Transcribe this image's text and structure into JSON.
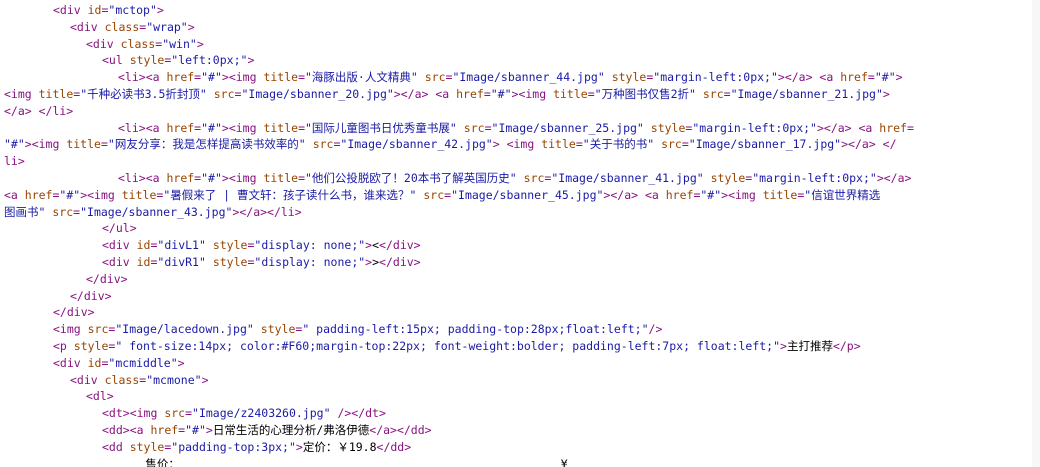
{
  "source": {
    "lines": [
      {
        "indent": 53,
        "segments": [
          [
            "t",
            "&lt;div "
          ],
          [
            "a",
            "id"
          ],
          [
            "t",
            "="
          ],
          [
            "v",
            "\"mctop\""
          ],
          [
            "t",
            "&gt;"
          ]
        ]
      },
      {
        "indent": 70,
        "segments": [
          [
            "t",
            "&lt;div "
          ],
          [
            "a",
            "class"
          ],
          [
            "t",
            "="
          ],
          [
            "v",
            "\"wrap\""
          ],
          [
            "t",
            "&gt;"
          ]
        ]
      },
      {
        "indent": 86,
        "segments": [
          [
            "t",
            "&lt;div "
          ],
          [
            "a",
            "class"
          ],
          [
            "t",
            "="
          ],
          [
            "v",
            "\"win\""
          ],
          [
            "t",
            "&gt;"
          ]
        ]
      },
      {
        "indent": 102,
        "segments": [
          [
            "t",
            "&lt;ul "
          ],
          [
            "a",
            "style"
          ],
          [
            "t",
            "="
          ],
          [
            "v",
            "\"left:0px;\""
          ],
          [
            "t",
            "&gt;"
          ]
        ]
      },
      {
        "indent": 118,
        "segments": [
          [
            "t",
            "&lt;li&gt;&lt;a "
          ],
          [
            "a",
            "href"
          ],
          [
            "t",
            "="
          ],
          [
            "v",
            "\"#\""
          ],
          [
            "t",
            "&gt;&lt;img "
          ],
          [
            "a",
            "title"
          ],
          [
            "t",
            "="
          ],
          [
            "v",
            "\"海豚出版·人文精典\""
          ],
          [
            "t",
            " "
          ],
          [
            "a",
            "src"
          ],
          [
            "t",
            "="
          ],
          [
            "v",
            "\"Image/sbanner_44.jpg\""
          ],
          [
            "t",
            " "
          ],
          [
            "a",
            "style"
          ],
          [
            "t",
            "="
          ],
          [
            "v",
            "\"margin-left:0px;\""
          ],
          [
            "t",
            "&gt;&lt;/a&gt; &lt;a "
          ],
          [
            "a",
            "href"
          ],
          [
            "t",
            "="
          ],
          [
            "v",
            "\"#\""
          ],
          [
            "t",
            "&gt;"
          ]
        ]
      },
      {
        "indent": 4,
        "segments": [
          [
            "t",
            "&lt;img "
          ],
          [
            "a",
            "title"
          ],
          [
            "t",
            "="
          ],
          [
            "v",
            "\"千种必读书3.5折封顶\""
          ],
          [
            "t",
            " "
          ],
          [
            "a",
            "src"
          ],
          [
            "t",
            "="
          ],
          [
            "v",
            "\"Image/sbanner_20.jpg\""
          ],
          [
            "t",
            "&gt;&lt;/a&gt; &lt;a "
          ],
          [
            "a",
            "href"
          ],
          [
            "t",
            "="
          ],
          [
            "v",
            "\"#\""
          ],
          [
            "t",
            "&gt;&lt;img "
          ],
          [
            "a",
            "title"
          ],
          [
            "t",
            "="
          ],
          [
            "v",
            "\"万种图书仅售2折\""
          ],
          [
            "t",
            " "
          ],
          [
            "a",
            "src"
          ],
          [
            "t",
            "="
          ],
          [
            "v",
            "\"Image/sbanner_21.jpg\""
          ],
          [
            "t",
            "&gt;"
          ]
        ]
      },
      {
        "indent": 4,
        "segments": [
          [
            "t",
            "&lt;/a&gt; &lt;/li&gt;"
          ]
        ]
      },
      {
        "indent": 118,
        "segments": [
          [
            "t",
            "&lt;li&gt;&lt;a "
          ],
          [
            "a",
            "href"
          ],
          [
            "t",
            "="
          ],
          [
            "v",
            "\"#\""
          ],
          [
            "t",
            "&gt;&lt;img "
          ],
          [
            "a",
            "title"
          ],
          [
            "t",
            "="
          ],
          [
            "v",
            "\"国际儿童图书日优秀童书展\""
          ],
          [
            "t",
            " "
          ],
          [
            "a",
            "src"
          ],
          [
            "t",
            "="
          ],
          [
            "v",
            "\"Image/sbanner_25.jpg\""
          ],
          [
            "t",
            " "
          ],
          [
            "a",
            "style"
          ],
          [
            "t",
            "="
          ],
          [
            "v",
            "\"margin-left:0px;\""
          ],
          [
            "t",
            "&gt;&lt;/a&gt; &lt;a "
          ],
          [
            "a",
            "href"
          ],
          [
            "t",
            "="
          ]
        ]
      },
      {
        "indent": 4,
        "segments": [
          [
            "v",
            "\"#\""
          ],
          [
            "t",
            "&gt;&lt;img "
          ],
          [
            "a",
            "title"
          ],
          [
            "t",
            "="
          ],
          [
            "v",
            "\"网友分享：我是怎样提高读书效率的\""
          ],
          [
            "t",
            " "
          ],
          [
            "a",
            "src"
          ],
          [
            "t",
            "="
          ],
          [
            "v",
            "\"Image/sbanner_42.jpg\""
          ],
          [
            "t",
            "&gt; &lt;img "
          ],
          [
            "a",
            "title"
          ],
          [
            "t",
            "="
          ],
          [
            "v",
            "\"关于书的书\""
          ],
          [
            "t",
            " "
          ],
          [
            "a",
            "src"
          ],
          [
            "t",
            "="
          ],
          [
            "v",
            "\"Image/sbanner_17.jpg\""
          ],
          [
            "t",
            "&gt;&lt;/a&gt; &lt;/"
          ]
        ]
      },
      {
        "indent": 4,
        "segments": [
          [
            "t",
            "li&gt;"
          ]
        ]
      },
      {
        "indent": 118,
        "segments": [
          [
            "t",
            "&lt;li&gt;&lt;a "
          ],
          [
            "a",
            "href"
          ],
          [
            "t",
            "="
          ],
          [
            "v",
            "\"#\""
          ],
          [
            "t",
            "&gt;&lt;img "
          ],
          [
            "a",
            "title"
          ],
          [
            "t",
            "="
          ],
          [
            "v",
            "\"他们公投脱欧了！20本书了解英国历史\""
          ],
          [
            "t",
            " "
          ],
          [
            "a",
            "src"
          ],
          [
            "t",
            "="
          ],
          [
            "v",
            "\"Image/sbanner_41.jpg\""
          ],
          [
            "t",
            " "
          ],
          [
            "a",
            "style"
          ],
          [
            "t",
            "="
          ],
          [
            "v",
            "\"margin-left:0px;\""
          ],
          [
            "t",
            "&gt;&lt;/a&gt;"
          ]
        ]
      },
      {
        "indent": 4,
        "segments": [
          [
            "t",
            "&lt;a "
          ],
          [
            "a",
            "href"
          ],
          [
            "t",
            "="
          ],
          [
            "v",
            "\"#\""
          ],
          [
            "t",
            "&gt;&lt;img "
          ],
          [
            "a",
            "title"
          ],
          [
            "t",
            "="
          ],
          [
            "v",
            "\"暑假来了 | 曹文轩：孩子读什么书，谁来选？\""
          ],
          [
            "t",
            " "
          ],
          [
            "a",
            "src"
          ],
          [
            "t",
            "="
          ],
          [
            "v",
            "\"Image/sbanner_45.jpg\""
          ],
          [
            "t",
            "&gt;&lt;/a&gt; &lt;a "
          ],
          [
            "a",
            "href"
          ],
          [
            "t",
            "="
          ],
          [
            "v",
            "\"#\""
          ],
          [
            "t",
            "&gt;&lt;img "
          ],
          [
            "a",
            "title"
          ],
          [
            "t",
            "="
          ],
          [
            "v",
            "\"信谊世界精选"
          ]
        ]
      },
      {
        "indent": 4,
        "segments": [
          [
            "v",
            "图画书\""
          ],
          [
            "t",
            " "
          ],
          [
            "a",
            "src"
          ],
          [
            "t",
            "="
          ],
          [
            "v",
            "\"Image/sbanner_43.jpg\""
          ],
          [
            "t",
            "&gt;&lt;/a&gt;&lt;/li&gt;"
          ]
        ]
      },
      {
        "indent": 102,
        "segments": [
          [
            "t",
            "&lt;/ul&gt;"
          ]
        ]
      },
      {
        "indent": 102,
        "segments": [
          [
            "t",
            "&lt;div "
          ],
          [
            "a",
            "id"
          ],
          [
            "t",
            "="
          ],
          [
            "v",
            "\"divL1\""
          ],
          [
            "t",
            " "
          ],
          [
            "a",
            "style"
          ],
          [
            "t",
            "="
          ],
          [
            "v",
            "\"display: none;\""
          ],
          [
            "t",
            "&gt;"
          ],
          [
            "x",
            "&lt;"
          ],
          [
            "t",
            "&lt;/div&gt;"
          ]
        ]
      },
      {
        "indent": 102,
        "segments": [
          [
            "t",
            "&lt;div "
          ],
          [
            "a",
            "id"
          ],
          [
            "t",
            "="
          ],
          [
            "v",
            "\"divR1\""
          ],
          [
            "t",
            " "
          ],
          [
            "a",
            "style"
          ],
          [
            "t",
            "="
          ],
          [
            "v",
            "\"display: none;\""
          ],
          [
            "t",
            "&gt;"
          ],
          [
            "x",
            "&gt;"
          ],
          [
            "t",
            "&lt;/div&gt;"
          ]
        ]
      },
      {
        "indent": 86,
        "segments": [
          [
            "t",
            "&lt;/div&gt;"
          ]
        ]
      },
      {
        "indent": 70,
        "segments": [
          [
            "t",
            "&lt;/div&gt;"
          ]
        ]
      },
      {
        "indent": 53,
        "segments": [
          [
            "t",
            "&lt;/div&gt;"
          ]
        ]
      },
      {
        "indent": 53,
        "segments": [
          [
            "t",
            "&lt;img "
          ],
          [
            "a",
            "src"
          ],
          [
            "t",
            "="
          ],
          [
            "v",
            "\"Image/lacedown.jpg\""
          ],
          [
            "t",
            " "
          ],
          [
            "a",
            "style"
          ],
          [
            "t",
            "="
          ],
          [
            "v",
            "\" padding-left:15px; padding-top:28px;float:left;\""
          ],
          [
            "t",
            "/&gt;"
          ]
        ]
      },
      {
        "indent": 53,
        "segments": [
          [
            "t",
            "&lt;p "
          ],
          [
            "a",
            "style"
          ],
          [
            "t",
            "="
          ],
          [
            "v",
            "\" font-size:14px; color:#F60;margin-top:22px; font-weight:bolder; padding-left:7px; float:left;\""
          ],
          [
            "t",
            "&gt;"
          ],
          [
            "x",
            "主打推荐"
          ],
          [
            "t",
            "&lt;/p&gt;"
          ]
        ]
      },
      {
        "indent": 53,
        "segments": [
          [
            "t",
            "&lt;div "
          ],
          [
            "a",
            "id"
          ],
          [
            "t",
            "="
          ],
          [
            "v",
            "\"mcmiddle\""
          ],
          [
            "t",
            "&gt;"
          ]
        ]
      },
      {
        "indent": 70,
        "segments": [
          [
            "t",
            "&lt;div "
          ],
          [
            "a",
            "class"
          ],
          [
            "t",
            "="
          ],
          [
            "v",
            "\"mcmone\""
          ],
          [
            "t",
            "&gt;"
          ]
        ]
      },
      {
        "indent": 86,
        "segments": [
          [
            "t",
            "&lt;dl&gt;"
          ]
        ]
      },
      {
        "indent": 102,
        "segments": [
          [
            "t",
            "&lt;dt&gt;&lt;img "
          ],
          [
            "a",
            "src"
          ],
          [
            "t",
            "="
          ],
          [
            "v",
            "\"Image/z2403260.jpg\""
          ],
          [
            "t",
            " /&gt;&lt;/dt&gt;"
          ]
        ]
      },
      {
        "indent": 102,
        "segments": [
          [
            "t",
            "&lt;dd&gt;&lt;a "
          ],
          [
            "a",
            "href"
          ],
          [
            "t",
            "="
          ],
          [
            "v",
            "\"#\""
          ],
          [
            "t",
            "&gt;"
          ],
          [
            "x",
            "日常生活的心理分析/弗洛伊德"
          ],
          [
            "t",
            "&lt;/a&gt;&lt;/dd&gt;"
          ]
        ]
      },
      {
        "indent": 102,
        "segments": [
          [
            "t",
            "&lt;dd "
          ],
          [
            "a",
            "style"
          ],
          [
            "t",
            "="
          ],
          [
            "v",
            "\"padding-top:3px;\""
          ],
          [
            "t",
            "&gt;"
          ],
          [
            "x",
            "定价：￥19.8"
          ],
          [
            "t",
            "&lt;/dd&gt;"
          ]
        ]
      }
    ],
    "clipped_line": "                     售价：                                                       ¥"
  },
  "colors": {
    "tag": "#881280",
    "attribute": "#994500",
    "value": "#1a1aa6",
    "text": "#000000"
  }
}
